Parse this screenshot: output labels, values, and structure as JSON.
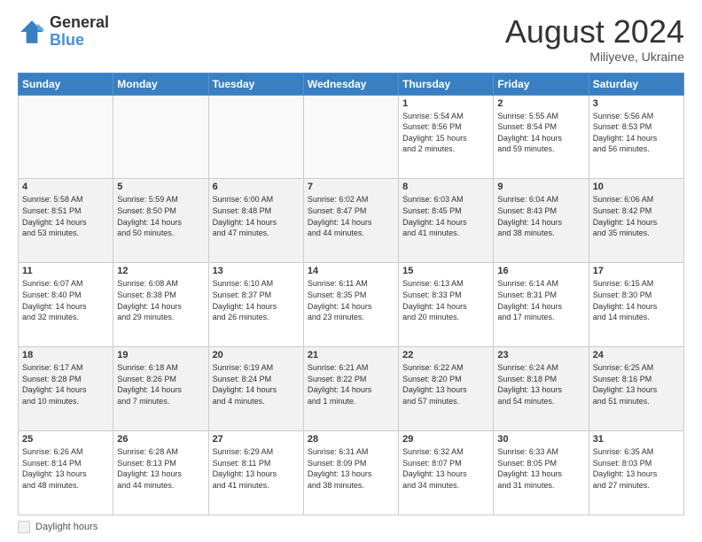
{
  "header": {
    "logo_general": "General",
    "logo_blue": "Blue",
    "month_title": "August 2024",
    "subtitle": "Miliyeve, Ukraine"
  },
  "legend": {
    "label": "Daylight hours"
  },
  "days_of_week": [
    "Sunday",
    "Monday",
    "Tuesday",
    "Wednesday",
    "Thursday",
    "Friday",
    "Saturday"
  ],
  "weeks": [
    [
      {
        "num": "",
        "info": ""
      },
      {
        "num": "",
        "info": ""
      },
      {
        "num": "",
        "info": ""
      },
      {
        "num": "",
        "info": ""
      },
      {
        "num": "1",
        "info": "Sunrise: 5:54 AM\nSunset: 8:56 PM\nDaylight: 15 hours\nand 2 minutes."
      },
      {
        "num": "2",
        "info": "Sunrise: 5:55 AM\nSunset: 8:54 PM\nDaylight: 14 hours\nand 59 minutes."
      },
      {
        "num": "3",
        "info": "Sunrise: 5:56 AM\nSunset: 8:53 PM\nDaylight: 14 hours\nand 56 minutes."
      }
    ],
    [
      {
        "num": "4",
        "info": "Sunrise: 5:58 AM\nSunset: 8:51 PM\nDaylight: 14 hours\nand 53 minutes."
      },
      {
        "num": "5",
        "info": "Sunrise: 5:59 AM\nSunset: 8:50 PM\nDaylight: 14 hours\nand 50 minutes."
      },
      {
        "num": "6",
        "info": "Sunrise: 6:00 AM\nSunset: 8:48 PM\nDaylight: 14 hours\nand 47 minutes."
      },
      {
        "num": "7",
        "info": "Sunrise: 6:02 AM\nSunset: 8:47 PM\nDaylight: 14 hours\nand 44 minutes."
      },
      {
        "num": "8",
        "info": "Sunrise: 6:03 AM\nSunset: 8:45 PM\nDaylight: 14 hours\nand 41 minutes."
      },
      {
        "num": "9",
        "info": "Sunrise: 6:04 AM\nSunset: 8:43 PM\nDaylight: 14 hours\nand 38 minutes."
      },
      {
        "num": "10",
        "info": "Sunrise: 6:06 AM\nSunset: 8:42 PM\nDaylight: 14 hours\nand 35 minutes."
      }
    ],
    [
      {
        "num": "11",
        "info": "Sunrise: 6:07 AM\nSunset: 8:40 PM\nDaylight: 14 hours\nand 32 minutes."
      },
      {
        "num": "12",
        "info": "Sunrise: 6:08 AM\nSunset: 8:38 PM\nDaylight: 14 hours\nand 29 minutes."
      },
      {
        "num": "13",
        "info": "Sunrise: 6:10 AM\nSunset: 8:37 PM\nDaylight: 14 hours\nand 26 minutes."
      },
      {
        "num": "14",
        "info": "Sunrise: 6:11 AM\nSunset: 8:35 PM\nDaylight: 14 hours\nand 23 minutes."
      },
      {
        "num": "15",
        "info": "Sunrise: 6:13 AM\nSunset: 8:33 PM\nDaylight: 14 hours\nand 20 minutes."
      },
      {
        "num": "16",
        "info": "Sunrise: 6:14 AM\nSunset: 8:31 PM\nDaylight: 14 hours\nand 17 minutes."
      },
      {
        "num": "17",
        "info": "Sunrise: 6:15 AM\nSunset: 8:30 PM\nDaylight: 14 hours\nand 14 minutes."
      }
    ],
    [
      {
        "num": "18",
        "info": "Sunrise: 6:17 AM\nSunset: 8:28 PM\nDaylight: 14 hours\nand 10 minutes."
      },
      {
        "num": "19",
        "info": "Sunrise: 6:18 AM\nSunset: 8:26 PM\nDaylight: 14 hours\nand 7 minutes."
      },
      {
        "num": "20",
        "info": "Sunrise: 6:19 AM\nSunset: 8:24 PM\nDaylight: 14 hours\nand 4 minutes."
      },
      {
        "num": "21",
        "info": "Sunrise: 6:21 AM\nSunset: 8:22 PM\nDaylight: 14 hours\nand 1 minute."
      },
      {
        "num": "22",
        "info": "Sunrise: 6:22 AM\nSunset: 8:20 PM\nDaylight: 13 hours\nand 57 minutes."
      },
      {
        "num": "23",
        "info": "Sunrise: 6:24 AM\nSunset: 8:18 PM\nDaylight: 13 hours\nand 54 minutes."
      },
      {
        "num": "24",
        "info": "Sunrise: 6:25 AM\nSunset: 8:16 PM\nDaylight: 13 hours\nand 51 minutes."
      }
    ],
    [
      {
        "num": "25",
        "info": "Sunrise: 6:26 AM\nSunset: 8:14 PM\nDaylight: 13 hours\nand 48 minutes."
      },
      {
        "num": "26",
        "info": "Sunrise: 6:28 AM\nSunset: 8:13 PM\nDaylight: 13 hours\nand 44 minutes."
      },
      {
        "num": "27",
        "info": "Sunrise: 6:29 AM\nSunset: 8:11 PM\nDaylight: 13 hours\nand 41 minutes."
      },
      {
        "num": "28",
        "info": "Sunrise: 6:31 AM\nSunset: 8:09 PM\nDaylight: 13 hours\nand 38 minutes."
      },
      {
        "num": "29",
        "info": "Sunrise: 6:32 AM\nSunset: 8:07 PM\nDaylight: 13 hours\nand 34 minutes."
      },
      {
        "num": "30",
        "info": "Sunrise: 6:33 AM\nSunset: 8:05 PM\nDaylight: 13 hours\nand 31 minutes."
      },
      {
        "num": "31",
        "info": "Sunrise: 6:35 AM\nSunset: 8:03 PM\nDaylight: 13 hours\nand 27 minutes."
      }
    ]
  ]
}
